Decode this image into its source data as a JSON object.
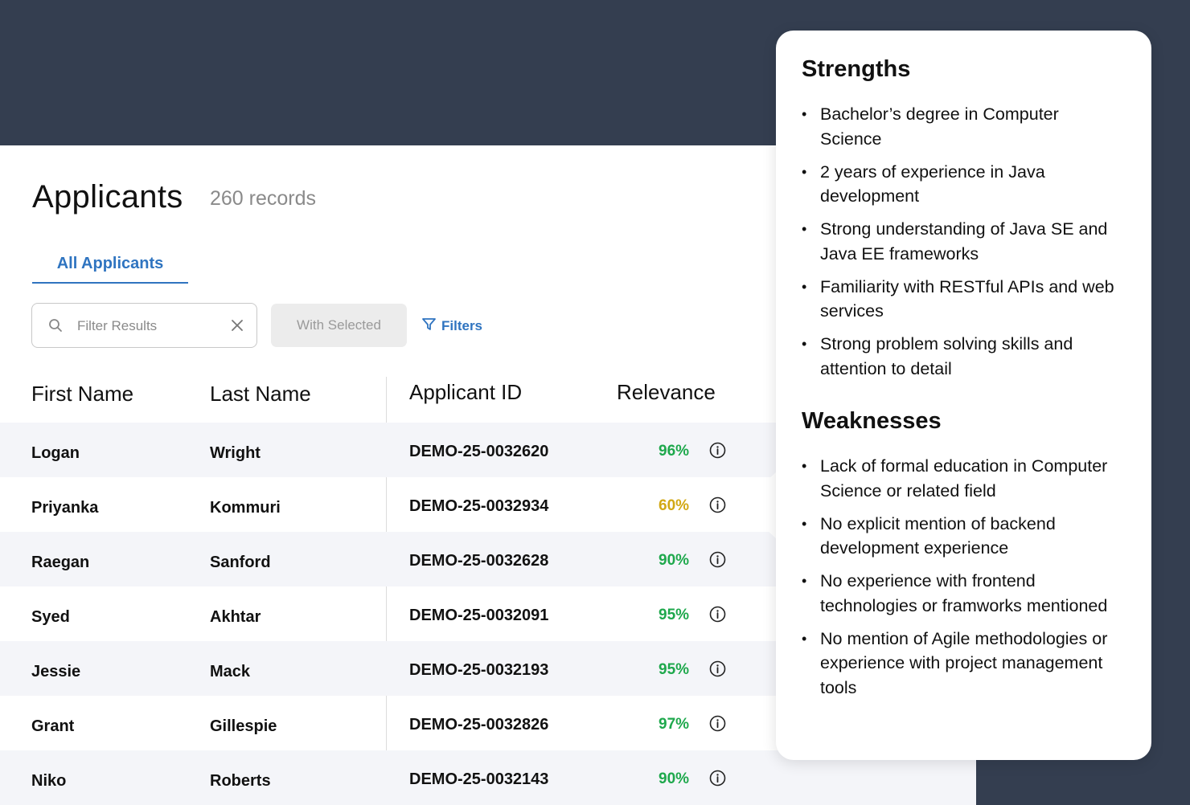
{
  "header": {
    "title": "Applicants",
    "record_count": "260 records"
  },
  "tabs": [
    {
      "label": "All Applicants",
      "active": true
    }
  ],
  "toolbar": {
    "search_placeholder": "Filter Results",
    "search_value": "",
    "with_selected_label": "With Selected",
    "filters_label": "Filters"
  },
  "table": {
    "columns": [
      "First Name",
      "Last Name",
      "Applicant ID",
      "Relevance"
    ],
    "rows": [
      {
        "first": "Logan",
        "last": "Wright",
        "id": "DEMO-25-0032620",
        "relevance": "96%",
        "level": "high"
      },
      {
        "first": "Priyanka",
        "last": "Kommuri",
        "id": "DEMO-25-0032934",
        "relevance": "60%",
        "level": "medium"
      },
      {
        "first": "Raegan",
        "last": "Sanford",
        "id": "DEMO-25-0032628",
        "relevance": "90%",
        "level": "high"
      },
      {
        "first": "Syed",
        "last": "Akhtar",
        "id": "DEMO-25-0032091",
        "relevance": "95%",
        "level": "high"
      },
      {
        "first": "Jessie",
        "last": "Mack",
        "id": "DEMO-25-0032193",
        "relevance": "95%",
        "level": "high"
      },
      {
        "first": "Grant",
        "last": "Gillespie",
        "id": "DEMO-25-0032826",
        "relevance": "97%",
        "level": "high"
      },
      {
        "first": "Niko",
        "last": "Roberts",
        "id": "DEMO-25-0032143",
        "relevance": "90%",
        "level": "high"
      }
    ]
  },
  "popover": {
    "strengths_title": "Strengths",
    "strengths": [
      "Bachelor’s degree in Computer Science",
      "2 years of experience in Java development",
      "Strong understanding of Java SE and Java EE frameworks",
      "Familiarity with RESTful APIs and web services",
      "Strong problem solving skills and attention to detail"
    ],
    "weaknesses_title": "Weaknesses",
    "weaknesses": [
      "Lack of formal education in Computer Science or related field",
      "No explicit mention of backend development experience",
      "No experience with frontend technologies or framworks mentioned",
      "No mention of Agile methodologies or experience with project management tools"
    ]
  },
  "colors": {
    "background": "#343e50",
    "accent": "#2f74c0",
    "relevance_high": "#1ea84c",
    "relevance_medium": "#d2a814",
    "row_alt": "#f4f5f9"
  },
  "icons": [
    "search-icon",
    "close-icon",
    "filter-icon",
    "info-icon"
  ]
}
